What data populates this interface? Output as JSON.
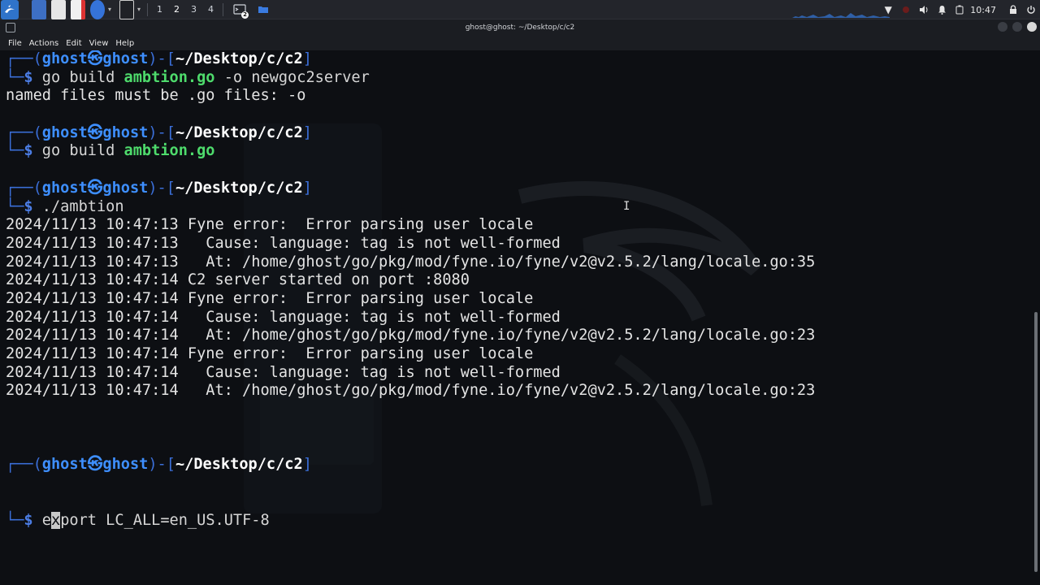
{
  "panel": {
    "workspaces": [
      "1",
      "2",
      "3",
      "4"
    ],
    "active_workspace": "2",
    "task_badge": "2",
    "clock": "10:47",
    "icons": [
      "kali-menu-icon",
      "desktop-icon",
      "files-icon",
      "text-editor-icon",
      "browser-icon",
      "terminal-icon",
      "network-icon",
      "volume-icon",
      "bell-icon",
      "battery-icon",
      "lock-icon",
      "power-icon"
    ]
  },
  "window": {
    "title": "ghost@ghost: ~/Desktop/c/c2"
  },
  "menu": [
    "File",
    "Actions",
    "Edit",
    "View",
    "Help"
  ],
  "prompt": {
    "user": "ghost",
    "host": "ghost",
    "path": "~/Desktop/c/c2",
    "dollar": "$"
  },
  "blocks": [
    {
      "cmd": [
        {
          "t": "go build ",
          "c": "gray"
        },
        {
          "t": "ambtion.go",
          "c": "greenb"
        },
        {
          "t": " -o newgoc2server",
          "c": "gray"
        }
      ],
      "output": [
        "named files must be .go files: -o"
      ]
    },
    {
      "cmd": [
        {
          "t": "go build ",
          "c": "gray"
        },
        {
          "t": "ambtion.go",
          "c": "greenb"
        }
      ],
      "output": []
    },
    {
      "cmd": [
        {
          "t": "./ambtion",
          "c": "gray"
        }
      ],
      "output": [
        "2024/11/13 10:47:13 Fyne error:  Error parsing user locale",
        "2024/11/13 10:47:13   Cause: language: tag is not well-formed",
        "2024/11/13 10:47:13   At: /home/ghost/go/pkg/mod/fyne.io/fyne/v2@v2.5.2/lang/locale.go:35",
        "2024/11/13 10:47:14 C2 server started on port :8080",
        "2024/11/13 10:47:14 Fyne error:  Error parsing user locale",
        "2024/11/13 10:47:14   Cause: language: tag is not well-formed",
        "2024/11/13 10:47:14   At: /home/ghost/go/pkg/mod/fyne.io/fyne/v2@v2.5.2/lang/locale.go:23",
        "2024/11/13 10:47:14 Fyne error:  Error parsing user locale",
        "2024/11/13 10:47:14   Cause: language: tag is not well-formed",
        "2024/11/13 10:47:14   At: /home/ghost/go/pkg/mod/fyne.io/fyne/v2@v2.5.2/lang/locale.go:23"
      ]
    }
  ],
  "current_input": {
    "before_cursor": "e",
    "cursor_char": "x",
    "after_cursor": "port LC_ALL=en_US.UTF-8"
  },
  "colors": {
    "prompt_frame": "#3b6fd9",
    "user": "#3e8fff",
    "green": "#4edb6c",
    "background": "#0d0f13"
  }
}
